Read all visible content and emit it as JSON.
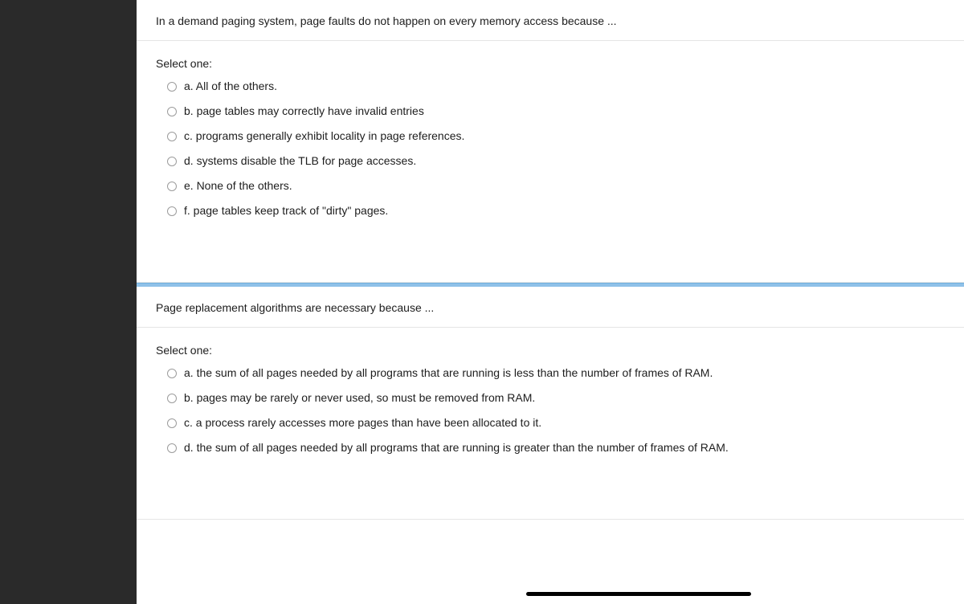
{
  "questions": [
    {
      "prompt": "In a demand paging system, page faults do not happen on every memory access because ...",
      "select_label": "Select one:",
      "options": [
        "a. All of the others.",
        "b. page tables may correctly have invalid entries",
        "c. programs generally exhibit locality in page references.",
        "d. systems disable the TLB for page accesses.",
        "e. None of the others.",
        "f. page tables keep track of \"dirty\" pages."
      ]
    },
    {
      "prompt": "Page replacement algorithms are necessary because ...",
      "select_label": "Select one:",
      "options": [
        "a. the sum of all pages needed by all programs that are running is less than the number of frames of RAM.",
        "b. pages may be rarely or never used, so must be removed from RAM.",
        "c. a process rarely accesses more pages than have been allocated to it.",
        "d. the sum of all pages needed by all programs that are running is greater than the number of frames of RAM."
      ]
    }
  ]
}
